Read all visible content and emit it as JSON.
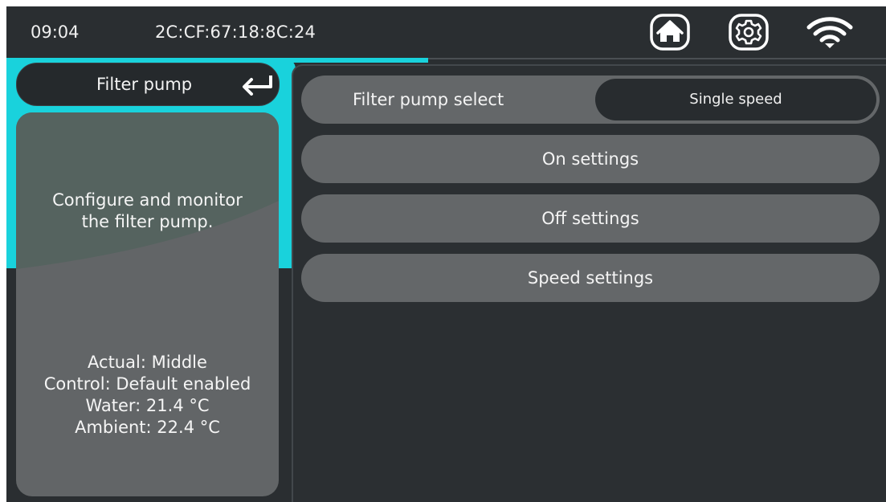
{
  "status_bar": {
    "time": "09:04",
    "mac": "2C:CF:67:18:8C:24",
    "icons": [
      "home-icon",
      "gear-icon",
      "wifi-icon"
    ]
  },
  "left": {
    "title": "Filter pump",
    "back_icon": "return-arrow-icon",
    "description_line1": "Configure and monitor",
    "description_line2": "the filter pump.",
    "status": {
      "actual": "Actual: Middle",
      "control": "Control: Default enabled",
      "water": "Water: 21.4 °C",
      "ambient": "Ambient: 22.4 °C"
    }
  },
  "main": {
    "select_label": "Filter pump select",
    "select_value": "Single speed",
    "buttons": {
      "on": "On settings",
      "off": "Off settings",
      "speed": "Speed settings"
    }
  },
  "colors": {
    "accent": "#19d2dc",
    "background": "#2a2e31",
    "pill": "#646769",
    "card_band": "#55635f"
  }
}
